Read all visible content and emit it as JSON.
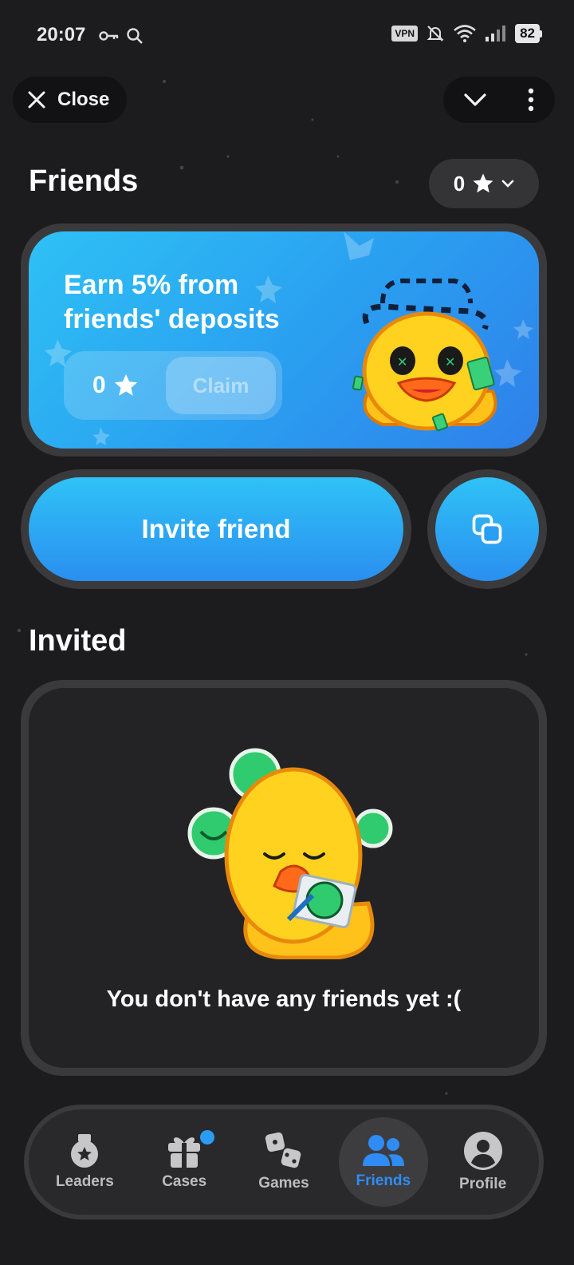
{
  "status_bar": {
    "time": "20:07",
    "vpn_label": "VPN",
    "battery": "82",
    "icons": [
      "key-icon",
      "search-icon",
      "mute-icon",
      "wifi-icon",
      "signal-icon",
      "battery-icon"
    ]
  },
  "top_bar": {
    "close_label": "Close",
    "icons": [
      "close-icon",
      "chevron-down-icon",
      "more-vertical-icon"
    ]
  },
  "page": {
    "title": "Friends",
    "balance": "0",
    "balance_icon": "star-icon"
  },
  "earn_card": {
    "title_line1": "Earn 5% from",
    "title_line2": "friends' deposits",
    "value": "0",
    "claim_label": "Claim"
  },
  "invite": {
    "button_label": "Invite friend",
    "copy_icon": "copy-icon"
  },
  "invited": {
    "heading": "Invited",
    "empty_message": "You don't have any friends yet :("
  },
  "nav": {
    "items": [
      {
        "label": "Leaders",
        "icon": "medal-icon",
        "active": false
      },
      {
        "label": "Cases",
        "icon": "gift-icon",
        "active": false,
        "badge": true
      },
      {
        "label": "Games",
        "icon": "dice-icon",
        "active": false
      },
      {
        "label": "Friends",
        "icon": "friends-icon",
        "active": true
      },
      {
        "label": "Profile",
        "icon": "profile-icon",
        "active": false
      }
    ]
  },
  "colors": {
    "accent_blue": "#2f8cf5",
    "gradient_start": "#2ec1f5",
    "gradient_end": "#2f80ea",
    "background": "#1c1c1e"
  }
}
